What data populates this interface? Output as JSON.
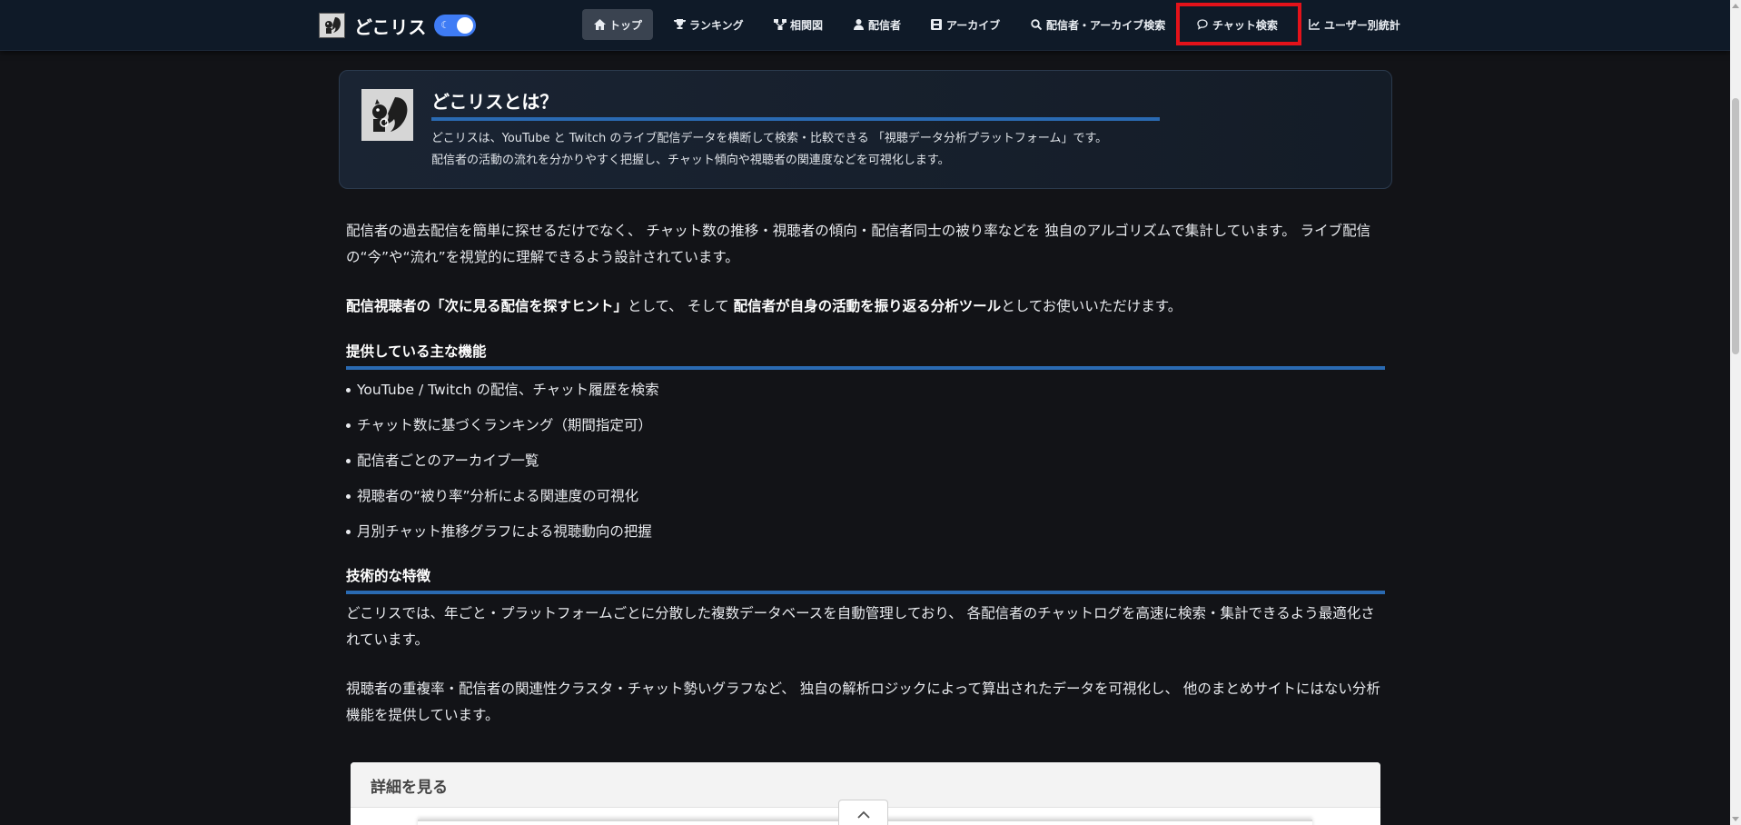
{
  "navbar": {
    "brand": "どこリス",
    "items": [
      {
        "label": "トップ",
        "icon": "home-icon",
        "active": true
      },
      {
        "label": "ランキング",
        "icon": "trophy-icon"
      },
      {
        "label": "相関図",
        "icon": "diagram-icon"
      },
      {
        "label": "配信者",
        "icon": "user-icon"
      },
      {
        "label": "アーカイブ",
        "icon": "film-icon"
      },
      {
        "label": "配信者・アーカイブ検索",
        "icon": "search-icon"
      },
      {
        "label": "チャット検索",
        "icon": "chat-icon",
        "highlighted": true
      },
      {
        "label": "ユーザー別統計",
        "icon": "chart-icon"
      }
    ]
  },
  "about": {
    "title": "どこリスとは？",
    "line1": "どこリスは、YouTube と Twitch のライブ配信データを横断して検索・比較できる 「視聴データ分析プラットフォーム」です。",
    "line2": "配信者の活動の流れを分かりやすく把握し、チャット傾向や視聴者の関連度などを可視化します。"
  },
  "intro": {
    "p1": "配信者の過去配信を簡単に探せるだけでなく、 チャット数の推移・視聴者の傾向・配信者同士の被り率などを 独自のアルゴリズムで集計しています。 ライブ配信の“今”や“流れ”を視覚的に理解できるよう設計されています。",
    "p2_bold1": "配信視聴者の「次に見る配信を探すヒント」",
    "p2_mid": "として、 そして ",
    "p2_bold2": "配信者が自身の活動を振り返る分析ツール",
    "p2_end": "としてお使いいただけます。"
  },
  "features": {
    "heading": "提供している主な機能",
    "items": [
      "YouTube / Twitch の配信、チャット履歴を検索",
      "チャット数に基づくランキング（期間指定可）",
      "配信者ごとのアーカイブ一覧",
      "視聴者の“被り率”分析による関連度の可視化",
      "月別チャット推移グラフによる視聴動向の把握"
    ]
  },
  "tech": {
    "heading": "技術的な特徴",
    "p1": "どこリスでは、年ごと・プラットフォームごとに分散した複数データベースを自動管理しており、 各配信者のチャットログを高速に検索・集計できるよう最適化されています。",
    "p2": "視聴者の重複率・配信者の関連性クラスタ・チャット勢いグラフなど、 独自の解析ロジックによって算出されたデータを可視化し、 他のまとめサイトにはない分析機能を提供しています。"
  },
  "details": {
    "title": "詳細を見る"
  },
  "colors": {
    "background": "#121317",
    "navbar": "#0f1a28",
    "accent_blue": "#2a6ab2",
    "toggle": "#3f7cf5",
    "highlight_red": "#e4121a"
  }
}
